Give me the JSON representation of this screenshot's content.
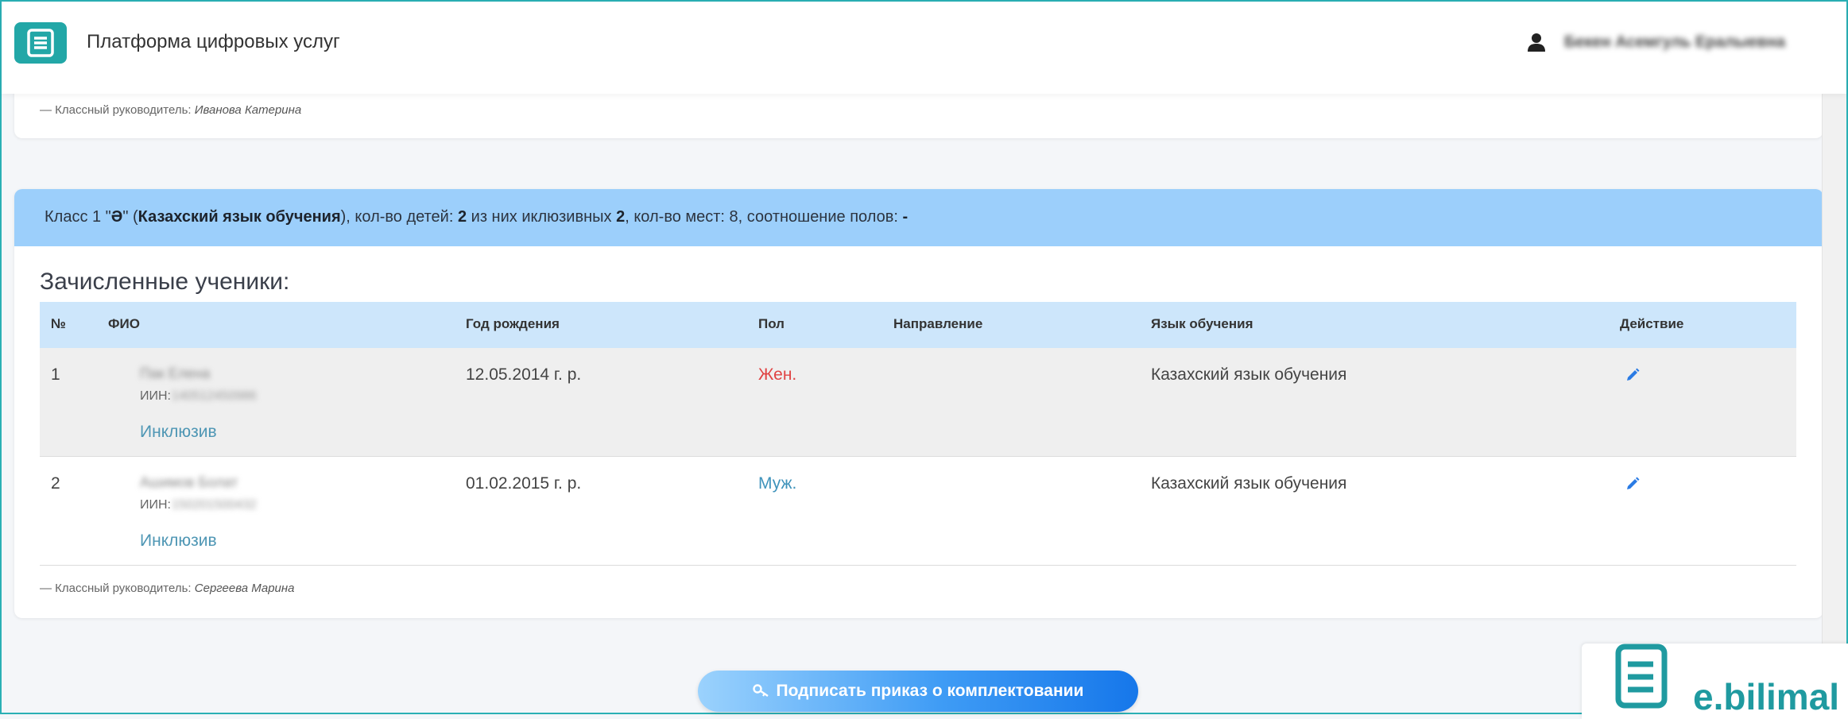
{
  "header": {
    "app_title": "Платформа цифровых услуг",
    "user_name": "Бекен Асемгуль Ералыевна"
  },
  "prev_class": {
    "teacher_label": "— Классный руководитель:",
    "teacher_name": "Иванова Катерина"
  },
  "class": {
    "prefix": "Класс 1 \"",
    "letter": "Ә",
    "mid1": "\" (",
    "language": "Казахский язык обучения",
    "mid2": "), кол-во детей: ",
    "children": "2",
    "mid3": " из них иклюзивных ",
    "inclusive": "2",
    "mid4": ", кол-во мест: 8, соотношение полов: ",
    "ratio": "-",
    "section_title": "Зачисленные ученики:",
    "teacher_label": "— Классный руководитель:",
    "teacher_name": "Сергеева Марина"
  },
  "table": {
    "headers": [
      "№",
      "ФИО",
      "Год рождения",
      "Пол",
      "Направление",
      "Язык обучения",
      "Действие"
    ],
    "rows": [
      {
        "num": "1",
        "name": "Пак Елена",
        "iin_label": "ИИН:",
        "iin": "140512450986",
        "tag": "Инклюзив",
        "birth": "12.05.2014 г. р.",
        "sex": "Жен.",
        "direction": "",
        "language": "Казахский язык обучения"
      },
      {
        "num": "2",
        "name": "Ашимов Болат",
        "iin_label": "ИИН:",
        "iin": "150201500432",
        "tag": "Инклюзив",
        "birth": "01.02.2015 г. р.",
        "sex": "Муж.",
        "direction": "",
        "language": "Казахский язык обучения"
      }
    ]
  },
  "actions": {
    "sign_label": "Подписать приказ о комплектовании"
  },
  "brand": {
    "name": "e.bilimal"
  },
  "icons": [
    "logo-icon",
    "user-icon",
    "pencil-icon",
    "key-icon",
    "brand-logo-icon"
  ],
  "colors": {
    "accent_teal": "#22a7a7",
    "header_blue": "#9ccffb",
    "table_head": "#cde6fb",
    "female": "#e04343",
    "male": "#3f93bb",
    "button_end": "#1677ea"
  }
}
